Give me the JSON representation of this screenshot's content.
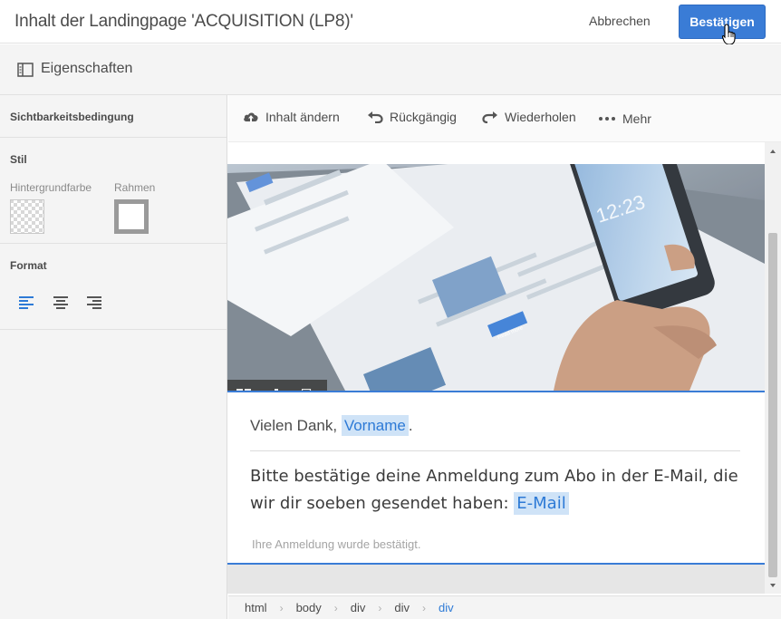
{
  "header": {
    "title": "Inhalt der Landingpage 'ACQUISITION (LP8)'",
    "cancel_label": "Abbrechen",
    "confirm_label": "Bestätigen"
  },
  "properties": {
    "label": "Eigenschaften"
  },
  "sidebar": {
    "visibility_label": "Sichtbarkeitsbedingung",
    "style_label": "Stil",
    "background_label": "Hintergrundfarbe",
    "border_label": "Rahmen",
    "format_label": "Format"
  },
  "toolbar": {
    "change_content": "Inhalt ändern",
    "undo": "Rückgängig",
    "redo": "Wiederholen",
    "more": "Mehr"
  },
  "content": {
    "thanks_prefix": "Vielen Dank,",
    "firstname_tag": "Vorname",
    "thanks_suffix": ".",
    "confirm_text": "Bitte bestätige deine Anmeldung zum Abo in der E-Mail, die wir dir soeben gesendet haben:",
    "email_tag": "E-Mail",
    "confirmation_note": "Ihre Anmeldung wurde bestätigt."
  },
  "hero": {
    "phone_time": "12:23",
    "button_text": "Read more"
  },
  "breadcrumb": [
    "html",
    "body",
    "div",
    "div",
    "div"
  ],
  "colors": {
    "accent": "#3a7cd6",
    "tag_bg": "#cfe3f7",
    "tag_text": "#2d7ad6"
  }
}
